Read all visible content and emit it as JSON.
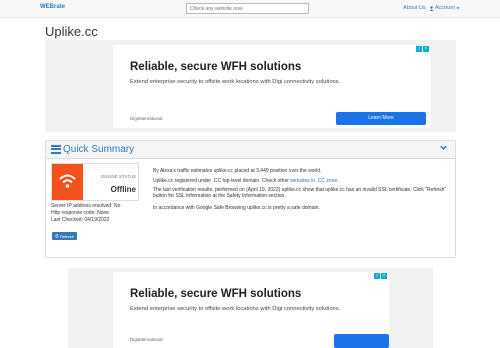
{
  "nav": {
    "brand": "WEBrate",
    "search_placeholder": "Check any website now",
    "about": "About Us",
    "account": "Account"
  },
  "site": {
    "title": "Uplike.cc"
  },
  "ads": [
    {
      "headline": "Reliable, secure WFH solutions",
      "desc": "Extend enterprise security to offsite work locations with Digi connectivity solutions.",
      "sponsor": "DigiInternational",
      "cta": "Learn More"
    },
    {
      "headline": "Reliable, secure WFH solutions",
      "desc": "Extend enterprise security to offsite work locations with Digi connectivity solutions.",
      "sponsor": "DigiInternational",
      "cta": ""
    }
  ],
  "summary": {
    "title": "Quick Summary",
    "status_label": "ONLINE STATUS",
    "status_value": "Offline",
    "status_color": "#f4511e",
    "ip": "Server IP address resolved: No",
    "http": "Http response code: None",
    "checked": "Last Checked: 04/19/2022",
    "refresh": "Refresh",
    "p1": "By Alexa's traffic estimates uplike.cc placed at 3,449 position over the world.",
    "p2_pre": "Uplike.cc registered under .CC top-level domain. Check other ",
    "p2_link": "websites in .CC zone",
    "p2_post": ".",
    "p3": "The last verification results, performed on (April 19, 2022) uplike.cc show that uplike.cc has an invalid SSL certificate. Click \"Refresh\" button for SSL Information at the Safety Information section.",
    "p4": "In accordance with Google Safe Browsing uplike.cc is pretty a safe domain."
  }
}
